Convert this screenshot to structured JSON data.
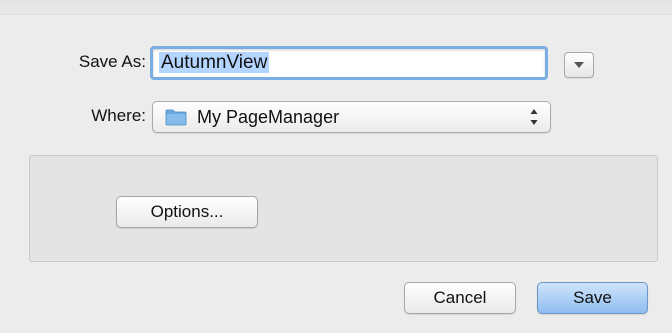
{
  "dialog": {
    "save_as_label": "Save As:",
    "file_name": "AutumnView",
    "where_label": "Where:",
    "where_value": "My PageManager",
    "options_label": "Options...",
    "cancel_label": "Cancel",
    "save_label": "Save"
  },
  "icons": {
    "expand": "chevron-down-icon",
    "folder": "folder-icon",
    "select_arrows": "up-down-arrows-icon"
  },
  "colors": {
    "focus_ring": "#7aaee3",
    "selection": "#b3d5ff",
    "default_button": "#8fbdf0",
    "folder": "#6aa9df"
  }
}
